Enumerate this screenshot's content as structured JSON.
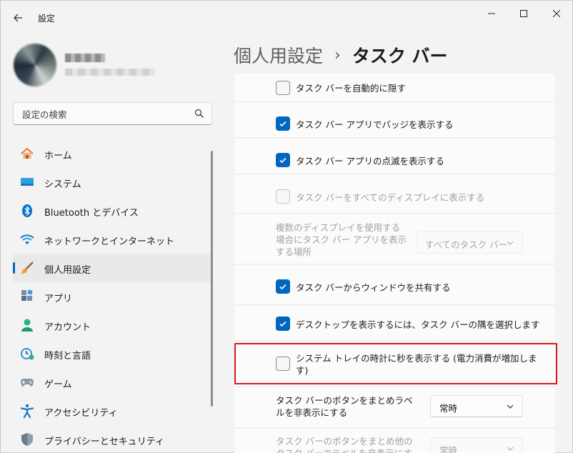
{
  "window": {
    "title": "設定"
  },
  "search": {
    "placeholder": "設定の検索"
  },
  "sidebar": {
    "items": [
      {
        "label": "ホーム",
        "icon": "home-icon"
      },
      {
        "label": "システム",
        "icon": "monitor-icon"
      },
      {
        "label": "Bluetooth とデバイス",
        "icon": "bluetooth-icon"
      },
      {
        "label": "ネットワークとインターネット",
        "icon": "wifi-icon"
      },
      {
        "label": "個人用設定",
        "icon": "brush-icon",
        "selected": true
      },
      {
        "label": "アプリ",
        "icon": "apps-icon"
      },
      {
        "label": "アカウント",
        "icon": "person-icon"
      },
      {
        "label": "時刻と言語",
        "icon": "clock-globe-icon"
      },
      {
        "label": "ゲーム",
        "icon": "gamepad-icon"
      },
      {
        "label": "アクセシビリティ",
        "icon": "accessibility-icon"
      },
      {
        "label": "プライバシーとセキュリティ",
        "icon": "shield-icon"
      }
    ]
  },
  "header": {
    "parent": "個人用設定",
    "separator": "›",
    "current": "タスク バー"
  },
  "settings": [
    {
      "label": "タスク バーを自動的に隠す",
      "checked": false,
      "enabled": true
    },
    {
      "label": "タスク バー アプリでバッジを表示する",
      "checked": true,
      "enabled": true
    },
    {
      "label": "タスク バー アプリの点滅を表示する",
      "checked": true,
      "enabled": true
    },
    {
      "label": "タスク バーをすべてのディスプレイに表示する",
      "checked": false,
      "enabled": false
    },
    {
      "label": "複数のディスプレイを使用する場合にタスク バー アプリを表示する場所",
      "dropdown": "すべてのタスク バー",
      "enabled": false
    },
    {
      "label": "タスク バーからウィンドウを共有する",
      "checked": true,
      "enabled": true
    },
    {
      "label": "デスクトップを表示するには、タスク バーの隅を選択します",
      "checked": true,
      "enabled": true
    },
    {
      "label": "システム トレイの時計に秒を表示する (電力消費が増加します)",
      "checked": false,
      "enabled": true,
      "highlighted": true
    },
    {
      "label": "タスク バーのボタンをまとめラベルを非表示にする",
      "dropdown": "常時",
      "enabled": true
    },
    {
      "label": "タスク バーのボタンをまとめ他のタスク バーでラベルを非表示にする",
      "dropdown": "常時",
      "enabled": false
    }
  ],
  "colors": {
    "accent": "#0067c0",
    "highlight_border": "#d8181c"
  }
}
